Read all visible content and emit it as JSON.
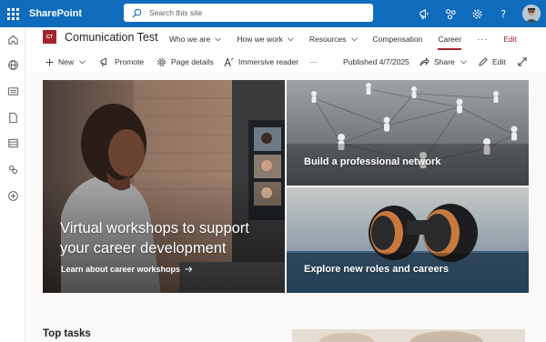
{
  "suite": {
    "app_name": "SharePoint",
    "search_placeholder": "Search this site",
    "icons": [
      "megaphone-icon",
      "sharepoint-network-icon",
      "gear-icon",
      "help-icon"
    ],
    "accent": "#0f6cbd"
  },
  "rail": {
    "icons": [
      "home-icon",
      "globe-icon",
      "news-icon",
      "files-icon",
      "lists-icon",
      "network-icon",
      "add-icon"
    ]
  },
  "site": {
    "logo_text": "CT",
    "logo_color": "#a4262c",
    "title": "Comunication Test",
    "nav": [
      {
        "label": "Who we are",
        "dropdown": true
      },
      {
        "label": "How we work",
        "dropdown": true
      },
      {
        "label": "Resources",
        "dropdown": true
      },
      {
        "label": "Compensation",
        "dropdown": false
      },
      {
        "label": "Career",
        "dropdown": false,
        "active": true
      }
    ],
    "more_label": "···",
    "edit_label": "Edit"
  },
  "commands": {
    "new_label": "New",
    "promote_label": "Promote",
    "page_details_label": "Page details",
    "immersive_label": "Immersive reader",
    "more_label": "···",
    "published_label": "Published 4/7/2025",
    "share_label": "Share",
    "edit_label": "Edit"
  },
  "hero": {
    "main_title": "Virtual workshops to support your career development",
    "main_link": "Learn about career workshops",
    "tile_a_title": "Build a professional network",
    "tile_b_title": "Explore new roles and careers"
  },
  "section": {
    "top_tasks_label": "Top tasks"
  }
}
